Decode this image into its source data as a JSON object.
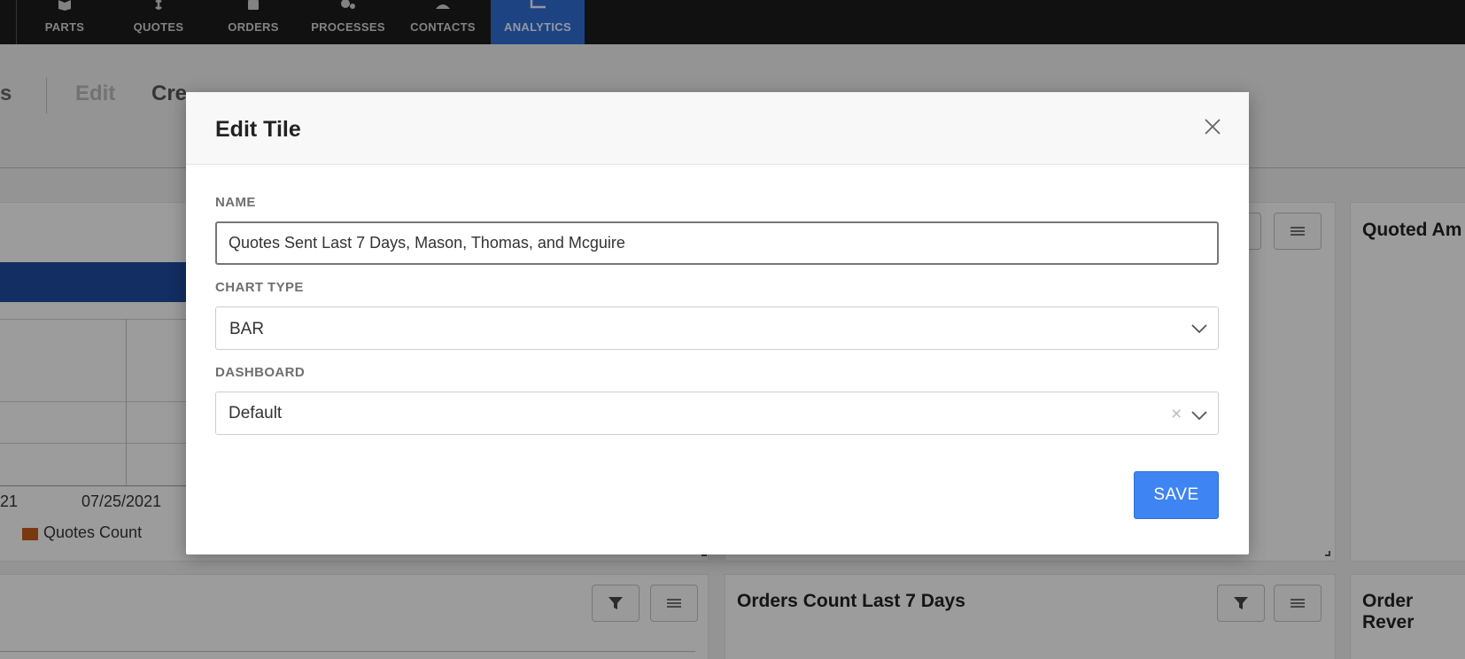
{
  "nav": {
    "items": [
      {
        "label": "PARTS",
        "icon": "box-icon"
      },
      {
        "label": "QUOTES",
        "icon": "dollar-icon"
      },
      {
        "label": "ORDERS",
        "icon": "clipboard-icon"
      },
      {
        "label": "PROCESSES",
        "icon": "gears-icon"
      },
      {
        "label": "CONTACTS",
        "icon": "person-icon"
      },
      {
        "label": "ANALYTICS",
        "icon": "chart-icon",
        "active": true
      }
    ]
  },
  "subnav": {
    "left_partial": "s",
    "edit": "Edit",
    "create_partial": "Cre"
  },
  "background": {
    "chart": {
      "x_label_partial": "21",
      "x_label": "07/25/2021",
      "legend": "Quotes Count",
      "legend_color": "#c25a1b"
    },
    "cards": {
      "quoted_amount_title": "Quoted Am",
      "orders_count_title": "Orders Count Last 7 Days",
      "order_revenue_title": "Order Rever"
    }
  },
  "modal": {
    "title": "Edit Tile",
    "name_label": "NAME",
    "name_value": "Quotes Sent Last 7 Days, Mason, Thomas, and Mcguire",
    "chart_type_label": "CHART TYPE",
    "chart_type_value": "BAR",
    "dashboard_label": "DASHBOARD",
    "dashboard_value": "Default",
    "save_label": "SAVE"
  },
  "colors": {
    "nav_bg": "#1c1c1c",
    "nav_active": "#2f6bd0",
    "save_button": "#3f84f3"
  }
}
